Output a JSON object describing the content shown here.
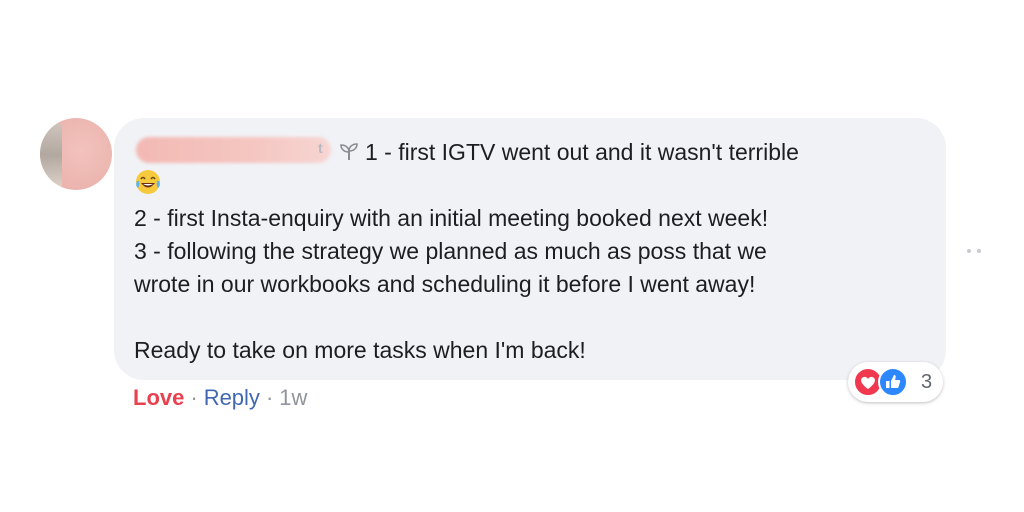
{
  "comment": {
    "author_fragment": "t",
    "lines": [
      "1 - first IGTV went out and it wasn't terrible",
      "2 - first Insta-enquiry with an initial meeting booked next week!",
      "3 - following the strategy we planned as much as poss that we",
      "wrote in our workbooks and scheduling it before I went away!",
      "Ready to take on more tasks when I'm back!"
    ],
    "emoji": "face-with-tears-of-joy-icon",
    "badge_icon": "sprout-icon"
  },
  "actions": {
    "love": "Love",
    "separator": "·",
    "reply": "Reply",
    "time": "1w"
  },
  "reactions": {
    "count": "3",
    "icons": [
      "heart-icon",
      "thumbs-up-icon"
    ]
  },
  "colors": {
    "bubble": "#f1f2f6",
    "love": "#e8414f",
    "link": "#4267b2",
    "muted": "#90949c"
  }
}
